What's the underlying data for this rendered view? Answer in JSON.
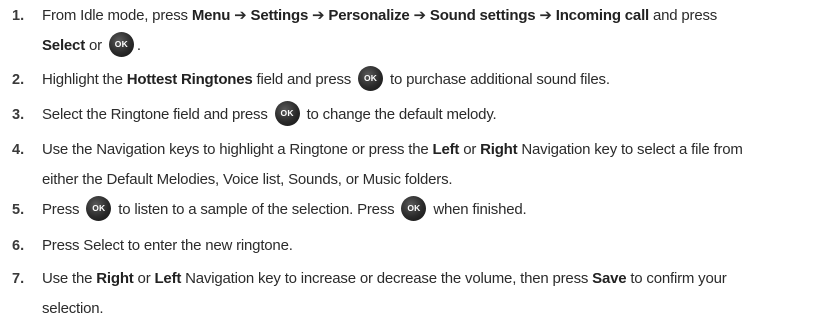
{
  "ok_key": {
    "label": "OK",
    "icon": "ok-key-icon"
  },
  "steps": [
    {
      "number": "1.",
      "lines": [
        [
          {
            "t": "From Idle mode, press "
          },
          {
            "b": "Menu"
          },
          {
            "t": " ➔ "
          },
          {
            "b": "Settings"
          },
          {
            "t": " ➔ "
          },
          {
            "b": "Personalize"
          },
          {
            "t": " ➔ "
          },
          {
            "b": "Sound settings"
          },
          {
            "t": " ➔ "
          },
          {
            "b": "Incoming call"
          },
          {
            "t": " and press"
          }
        ],
        [
          {
            "b": "Select"
          },
          {
            "t": " or "
          },
          {
            "ok": true
          },
          {
            "t": "."
          }
        ]
      ]
    },
    {
      "number": "2.",
      "lines": [
        [
          {
            "t": "Highlight the "
          },
          {
            "b": "Hottest Ringtones"
          },
          {
            "t": " field and press "
          },
          {
            "ok": true
          },
          {
            "t": " to purchase additional sound files."
          }
        ]
      ]
    },
    {
      "number": "3.",
      "lines": [
        [
          {
            "t": "Select the Ringtone field and press "
          },
          {
            "ok": true
          },
          {
            "t": " to change the default melody."
          }
        ]
      ]
    },
    {
      "number": "4.",
      "lines": [
        [
          {
            "t": "Use the Navigation keys to highlight a Ringtone or press the "
          },
          {
            "b": "Left"
          },
          {
            "t": " or "
          },
          {
            "b": "Right"
          },
          {
            "t": " Navigation key to select a file from"
          }
        ],
        [
          {
            "t": "either the Default Melodies, Voice list, Sounds, or Music folders."
          }
        ]
      ]
    },
    {
      "number": "5.",
      "lines": [
        [
          {
            "t": "Press "
          },
          {
            "ok": true
          },
          {
            "t": " to listen to a sample of the selection. Press "
          },
          {
            "ok": true
          },
          {
            "t": " when finished."
          }
        ]
      ]
    },
    {
      "number": "6.",
      "lines": [
        [
          {
            "t": "Press Select to enter the new ringtone."
          }
        ]
      ]
    },
    {
      "number": "7.",
      "lines": [
        [
          {
            "t": "Use the "
          },
          {
            "b": "Right"
          },
          {
            "t": " or "
          },
          {
            "b": "Left"
          },
          {
            "t": " Navigation key to increase or decrease the volume, then press "
          },
          {
            "b": "Save"
          },
          {
            "t": " to confirm your"
          }
        ],
        [
          {
            "t": "selection."
          }
        ]
      ]
    }
  ]
}
